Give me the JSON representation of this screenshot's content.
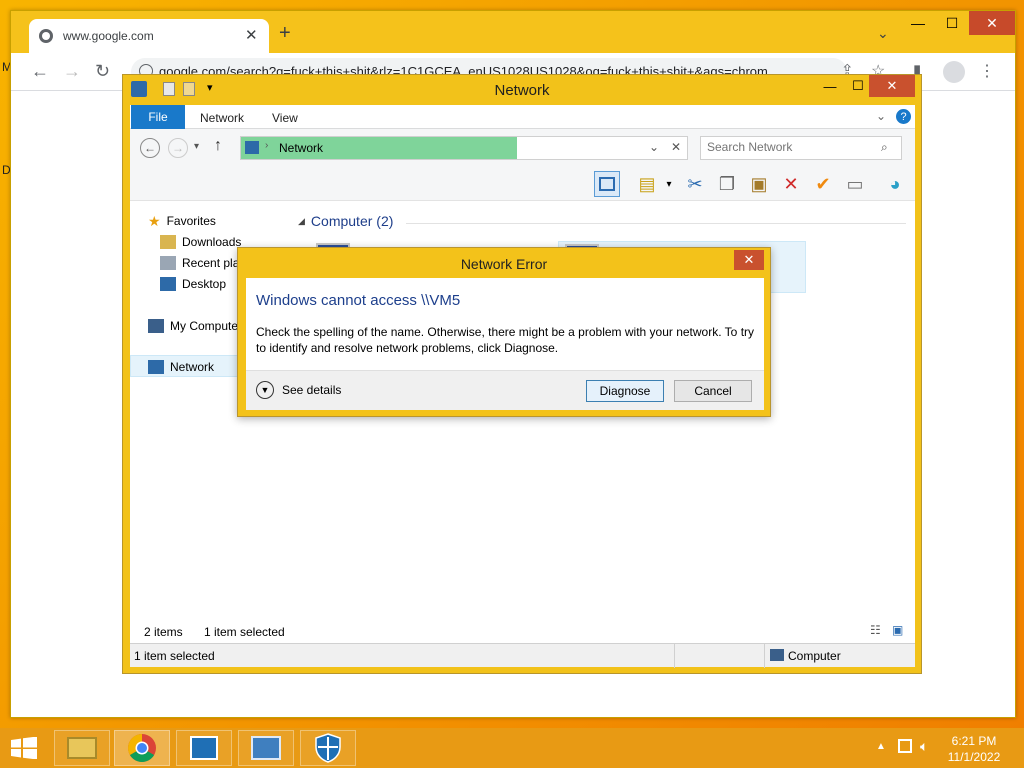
{
  "chrome": {
    "tab_title": "www.google.com",
    "url": "google.com/search?q=fuck+this+shit&rlz=1C1GCEA_enUS1028US1028&oq=fuck+this+shit+&aqs=chrom"
  },
  "desktop": {
    "edge_glyph_1": "M",
    "edge_glyph_2": "D"
  },
  "explorer": {
    "title": "Network",
    "tabs": {
      "file": "File",
      "network": "Network",
      "view": "View"
    },
    "address": "Network",
    "search_placeholder": "Search Network",
    "nav": {
      "favorites": "Favorites",
      "downloads": "Downloads",
      "recent": "Recent pla",
      "desktop": "Desktop",
      "my_computer": "My Compute",
      "network": "Network"
    },
    "group_header": "Computer (2)",
    "status_items": "2 items",
    "status_selected": "1 item selected",
    "statusbar_left": "1 item selected",
    "statusbar_right": "Computer"
  },
  "dialog": {
    "title": "Network Error",
    "heading": "Windows cannot access \\\\VM5",
    "message": "Check the spelling of the name. Otherwise, there might be a problem with your network. To try to identify and resolve network problems, click Diagnose.",
    "details_label": "See details",
    "diagnose_label": "Diagnose",
    "cancel_label": "Cancel"
  },
  "taskbar": {
    "time": "6:21 PM",
    "date": "11/1/2022"
  },
  "colors": {
    "accent": "#f5c21b",
    "file_tab": "#1979ca",
    "close": "#c9512e",
    "address_highlight": "#7fd49a",
    "link_heading": "#1d3f8c"
  }
}
